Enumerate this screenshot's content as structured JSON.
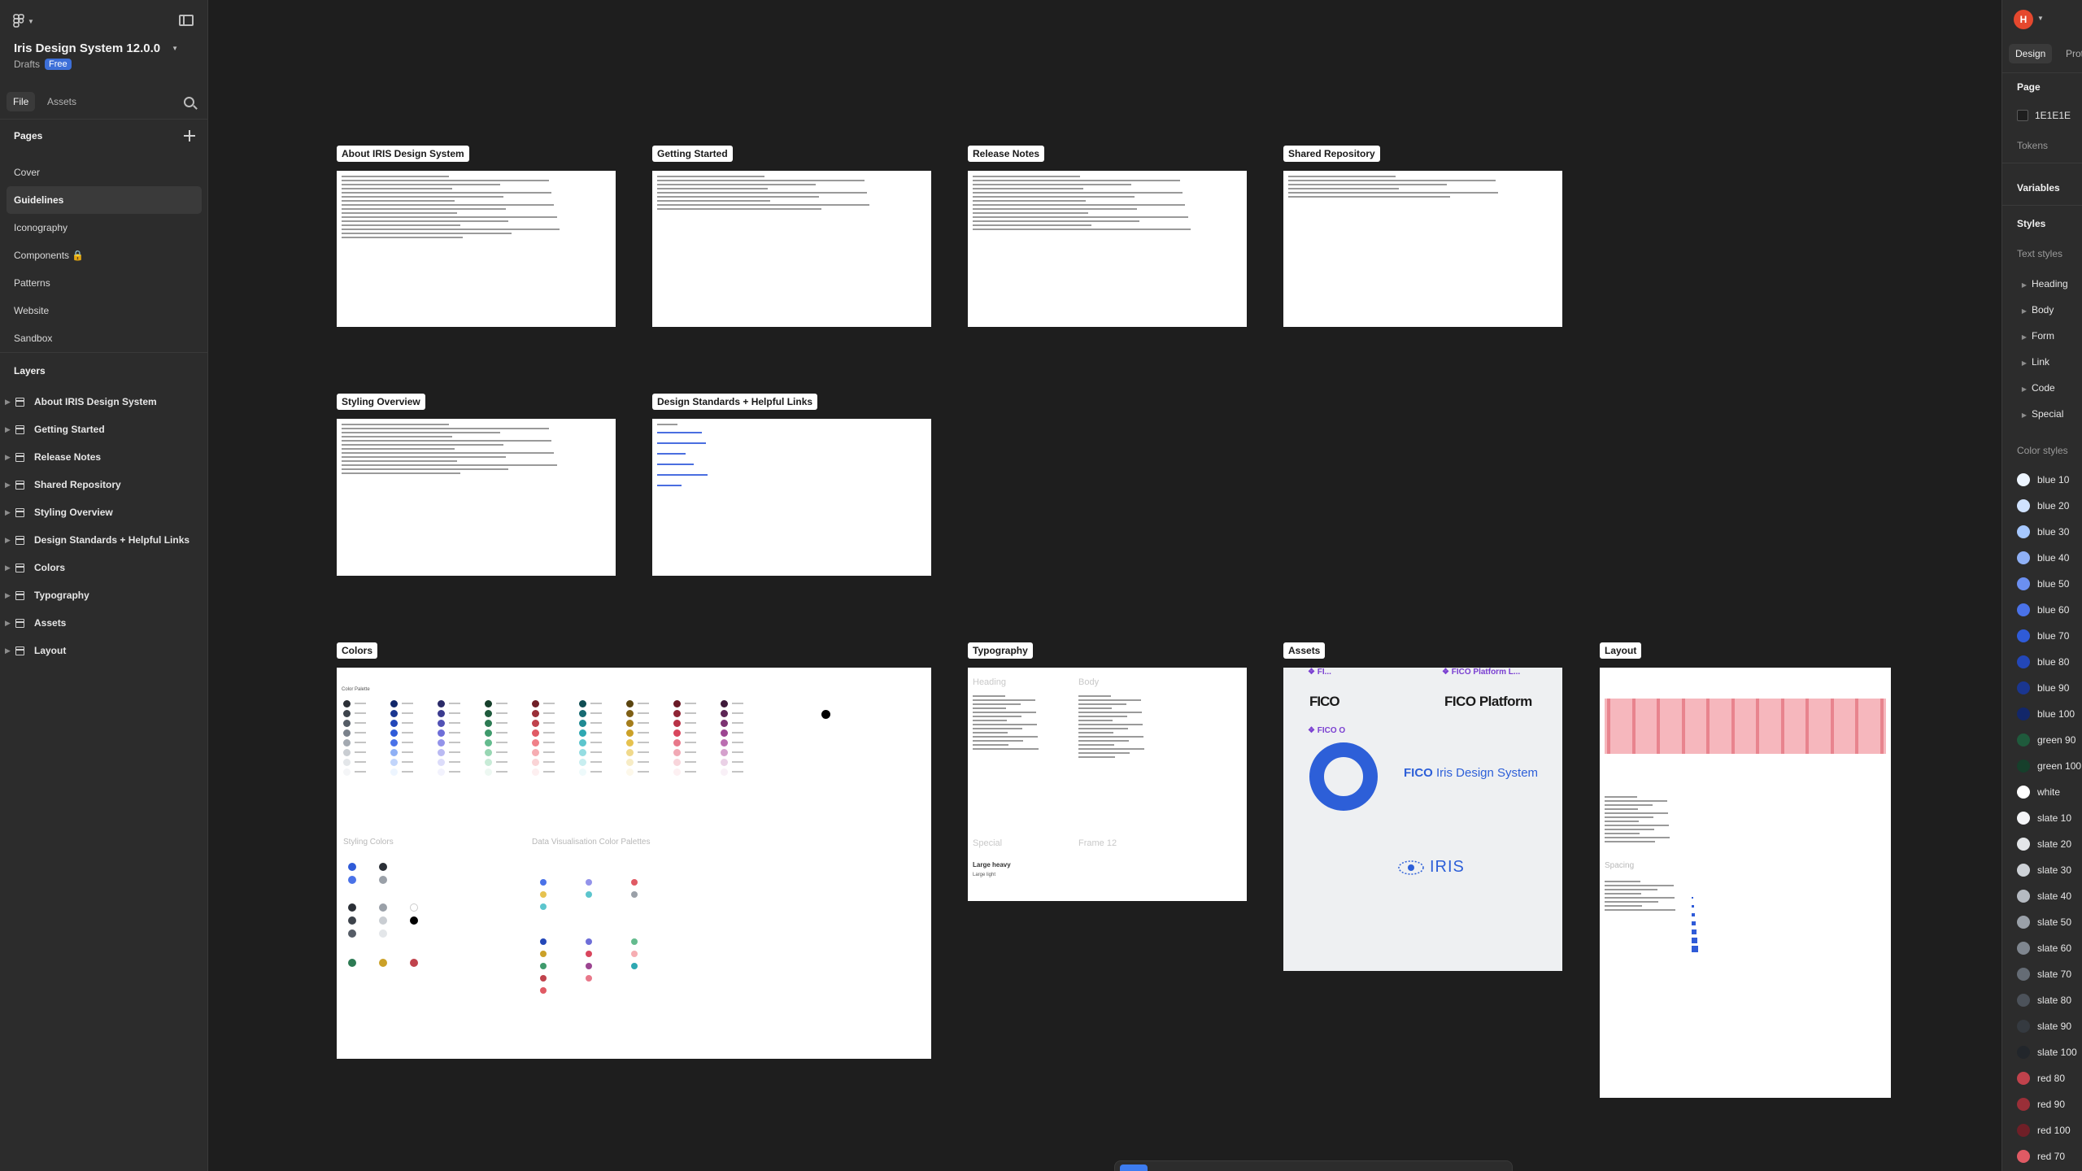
{
  "left": {
    "file_name": "Iris Design System 12.0.0",
    "location": "Drafts",
    "plan_badge": "Free",
    "tabs": [
      "File",
      "Assets"
    ],
    "pages_title": "Pages",
    "pages": [
      "Cover",
      "Guidelines",
      "Iconography",
      "Components 🔒",
      "Patterns",
      "Website",
      "Sandbox"
    ],
    "active_page": "Guidelines",
    "layers_title": "Layers",
    "layers": [
      "About IRIS Design System",
      "Getting Started",
      "Release Notes",
      "Shared Repository",
      "Styling Overview",
      "Design Standards + Helpful Links",
      "Colors",
      "Typography",
      "Assets",
      "Layout"
    ]
  },
  "canvas": {
    "frames": [
      {
        "label": "About IRIS Design System"
      },
      {
        "label": "Getting Started"
      },
      {
        "label": "Release Notes"
      },
      {
        "label": "Shared Repository"
      },
      {
        "label": "Styling Overview"
      },
      {
        "label": "Design Standards + Helpful Links"
      },
      {
        "label": "Colors"
      },
      {
        "label": "Typography"
      },
      {
        "label": "Assets"
      },
      {
        "label": "Layout"
      }
    ],
    "colors_frame": {
      "palette_title": "Color Palette",
      "styling_title": "Styling Colors",
      "dataviz_title": "Data Visualisation Color Palettes"
    },
    "typography_frame": {
      "heading": "Heading",
      "body": "Body",
      "special": "Special",
      "frame12": "Frame 12",
      "large_heavy": "Large heavy",
      "large_light": "Large light"
    },
    "assets_frame": {
      "fico_small": "FICO",
      "fico_platform": "FICO Platform",
      "fico_platform_label": "❖ FICO Platform L...",
      "fico_label": "❖ FI...",
      "fico_o_label": "❖ FICO O",
      "fico_iris": "Iris Design System",
      "fico_word": "FICO",
      "iris": "IRIS"
    },
    "layout_frame": {
      "spacing_title": "Spacing"
    }
  },
  "right": {
    "avatar_initial": "H",
    "tabs": [
      "Design",
      "Prototype"
    ],
    "page_title": "Page",
    "page_color": "1E1E1E",
    "tokens": "Tokens",
    "variables": "Variables",
    "styles": "Styles",
    "text_styles_title": "Text styles",
    "text_styles": [
      "Heading",
      "Body",
      "Form",
      "Link",
      "Code",
      "Special"
    ],
    "color_styles_title": "Color styles",
    "color_styles": [
      {
        "name": "blue 10",
        "color": "#edf5ff"
      },
      {
        "name": "blue 20",
        "color": "#d0e2ff"
      },
      {
        "name": "blue 30",
        "color": "#a6c8ff"
      },
      {
        "name": "blue 40",
        "color": "#8fb0f5"
      },
      {
        "name": "blue 50",
        "color": "#6b8ff0"
      },
      {
        "name": "blue 60",
        "color": "#4a72e8"
      },
      {
        "name": "blue 70",
        "color": "#2f5bd8"
      },
      {
        "name": "blue 80",
        "color": "#2347b8"
      },
      {
        "name": "blue 90",
        "color": "#1a3690"
      },
      {
        "name": "blue 100",
        "color": "#12276a"
      },
      {
        "name": "green 90",
        "color": "#1f5a3c"
      },
      {
        "name": "green 100",
        "color": "#163f2b"
      },
      {
        "name": "white",
        "color": "#ffffff"
      },
      {
        "name": "slate 10",
        "color": "#f4f5f7"
      },
      {
        "name": "slate 20",
        "color": "#e3e5e8"
      },
      {
        "name": "slate 30",
        "color": "#cdd1d6"
      },
      {
        "name": "slate 40",
        "color": "#b5bac1"
      },
      {
        "name": "slate 50",
        "color": "#9aa0a8"
      },
      {
        "name": "slate 60",
        "color": "#7f868f"
      },
      {
        "name": "slate 70",
        "color": "#656c75"
      },
      {
        "name": "slate 80",
        "color": "#4c525a"
      },
      {
        "name": "slate 90",
        "color": "#353a40"
      },
      {
        "name": "slate 100",
        "color": "#22262b"
      },
      {
        "name": "red 80",
        "color": "#c0424c"
      },
      {
        "name": "red 90",
        "color": "#9a2f38"
      },
      {
        "name": "red 100",
        "color": "#6f1f27"
      },
      {
        "name": "red 70",
        "color": "#e05a64"
      }
    ]
  }
}
